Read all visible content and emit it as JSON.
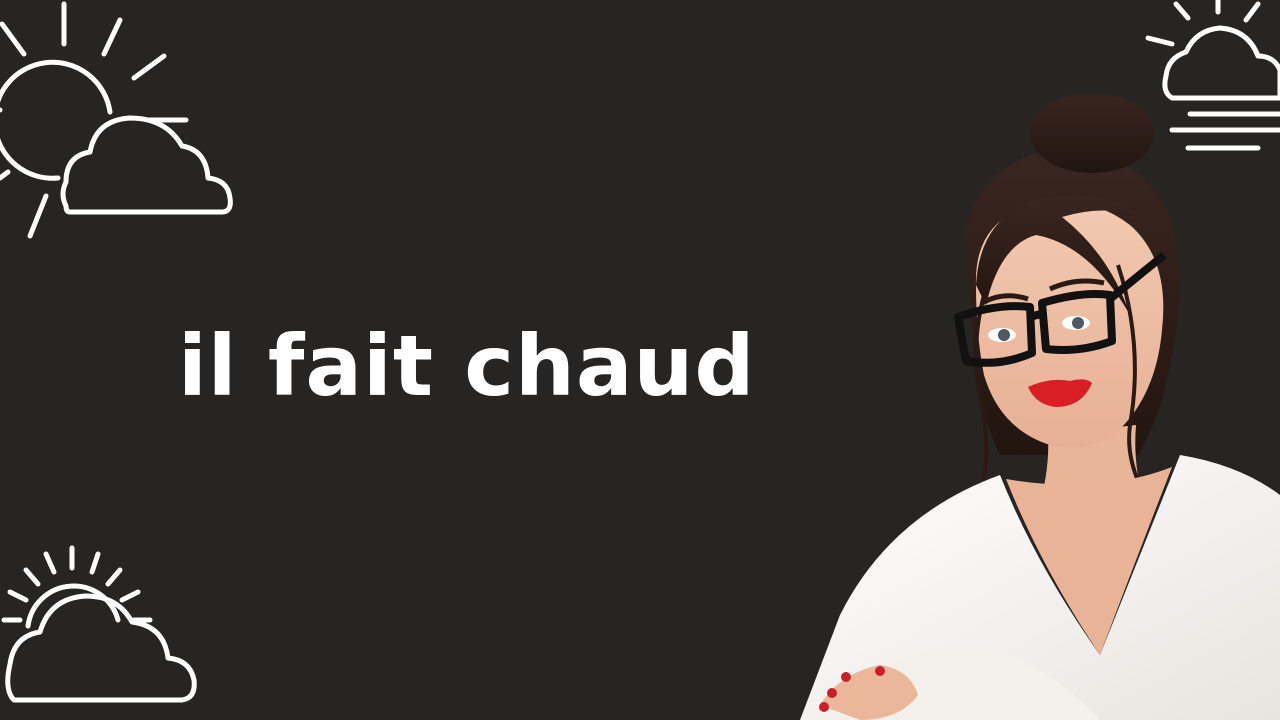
{
  "headline": {
    "text": "il fait chaud"
  },
  "icons": {
    "top_left": "sun-behind-cloud-icon",
    "bottom_left": "sunrise-cloud-icon",
    "top_right": "sun-cloud-haze-icon"
  },
  "portrait": {
    "subject": "woman-in-white-blouse-with-glasses-portrait"
  },
  "colors": {
    "background": "#262523",
    "text": "#ffffff",
    "icon_stroke": "#ffffff",
    "lips": "#d81f26",
    "blouse": "#f3f1ee"
  }
}
